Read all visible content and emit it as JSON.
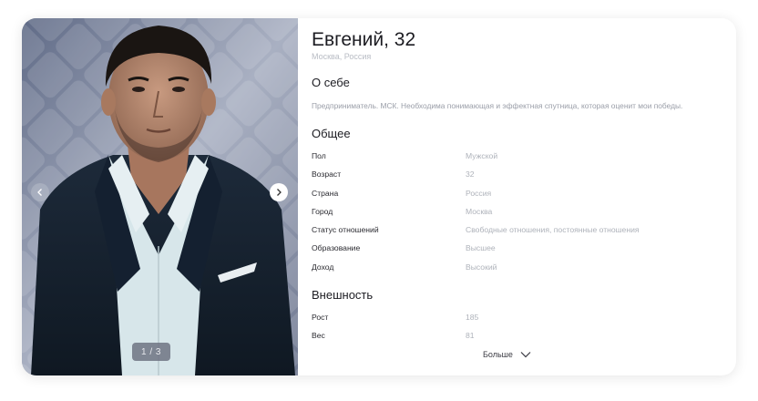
{
  "profile": {
    "name": "Евгений, 32",
    "location": "Москва, Россия"
  },
  "photo": {
    "counter": "1 / 3",
    "prev_icon": "chevron-left-icon",
    "next_icon": "chevron-right-icon"
  },
  "about": {
    "title": "О себе",
    "text": "Предприниматель. МСК. Необходима понимающая и эффектная спутница, которая оценит мои победы."
  },
  "general": {
    "title": "Общее",
    "rows": [
      {
        "label": "Пол",
        "value": "Мужской"
      },
      {
        "label": "Возраст",
        "value": "32"
      },
      {
        "label": "Страна",
        "value": "Россия"
      },
      {
        "label": "Город",
        "value": "Москва"
      },
      {
        "label": "Статус отношений",
        "value": "Свободные отношения, постоянные отношения"
      },
      {
        "label": "Образование",
        "value": "Высшее"
      },
      {
        "label": "Доход",
        "value": "Высокий"
      }
    ]
  },
  "appearance": {
    "title": "Внешность",
    "rows": [
      {
        "label": "Рост",
        "value": "185"
      },
      {
        "label": "Вес",
        "value": "81"
      }
    ]
  },
  "more": {
    "label": "Больше",
    "icon": "chevron-down-icon"
  }
}
